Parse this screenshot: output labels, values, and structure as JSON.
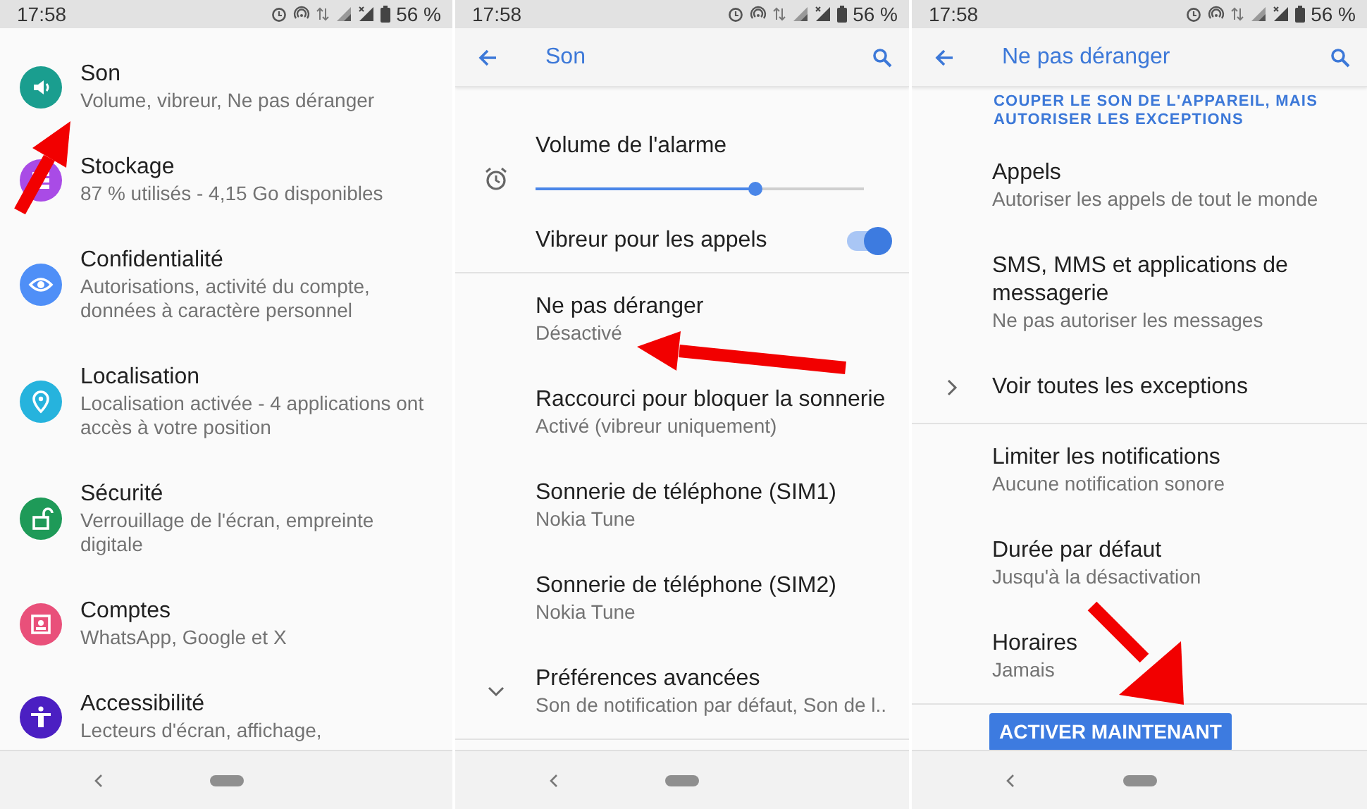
{
  "panels": [
    {
      "status_bar": {
        "time": "17:58",
        "battery": "56 %"
      },
      "items": [
        {
          "title": "Son",
          "subtitle": "Volume, vibreur, Ne pas déranger",
          "color": "#1a9e8f"
        },
        {
          "title": "Stockage",
          "subtitle": "87 % utilisés - 4,15 Go disponibles",
          "color": "#a94be6"
        },
        {
          "title": "Confidentialité",
          "subtitle": "Autorisations, activité du compte, données à caractère personnel",
          "color": "#4f8ff7"
        },
        {
          "title": "Localisation",
          "subtitle": "Localisation activée - 4 applications ont accès à votre position",
          "color": "#26b3dd"
        },
        {
          "title": "Sécurité",
          "subtitle": "Verrouillage de l'écran, empreinte digitale",
          "color": "#1e9a58"
        },
        {
          "title": "Comptes",
          "subtitle": "WhatsApp, Google et X",
          "color": "#e9507a"
        },
        {
          "title": "Accessibilité",
          "subtitle": "Lecteurs d'écran, affichage,",
          "color": "#4b1fc2"
        }
      ]
    },
    {
      "status_bar": {
        "time": "17:58",
        "battery": "56 %"
      },
      "app_bar": {
        "title": "Son"
      },
      "groups": [
        [
          {
            "kind": "slider",
            "title": "Volume de l'alarme",
            "level": 0.67
          },
          {
            "kind": "switch",
            "title": "Vibreur pour les appels",
            "on": true
          }
        ],
        [
          {
            "kind": "text",
            "title": "Ne pas déranger",
            "subtitle": "Désactivé"
          },
          {
            "kind": "text",
            "title": "Raccourci pour bloquer la sonnerie",
            "subtitle": "Activé (vibreur uniquement)"
          },
          {
            "kind": "text",
            "title": "Sonnerie de téléphone (SIM1)",
            "subtitle": "Nokia Tune"
          },
          {
            "kind": "text",
            "title": "Sonnerie de téléphone (SIM2)",
            "subtitle": "Nokia Tune"
          },
          {
            "kind": "expand",
            "title": "Préférences avancées",
            "subtitle": "Son de notification par défaut, Son de l.."
          }
        ]
      ]
    },
    {
      "status_bar": {
        "time": "17:58",
        "battery": "56 %"
      },
      "app_bar": {
        "title": "Ne pas déranger"
      },
      "groups": [
        [
          {
            "kind": "header",
            "title": "COUPER LE SON DE L'APPAREIL, MAIS AUTORISER LES EXCEPTIONS"
          },
          {
            "kind": "text",
            "title": "Appels",
            "subtitle": "Autoriser les appels de tout le monde"
          },
          {
            "kind": "text",
            "title": "SMS, MMS et applications de messagerie",
            "subtitle": "Ne pas autoriser les messages"
          },
          {
            "kind": "more",
            "title": "Voir toutes les exceptions"
          }
        ],
        [
          {
            "kind": "text",
            "title": "Limiter les notifications",
            "subtitle": "Aucune notification sonore"
          },
          {
            "kind": "text",
            "title": "Durée par défaut",
            "subtitle": "Jusqu'à la désactivation"
          },
          {
            "kind": "text",
            "title": "Horaires",
            "subtitle": "Jamais"
          }
        ]
      ],
      "button": "ACTIVER MAINTENANT"
    }
  ]
}
